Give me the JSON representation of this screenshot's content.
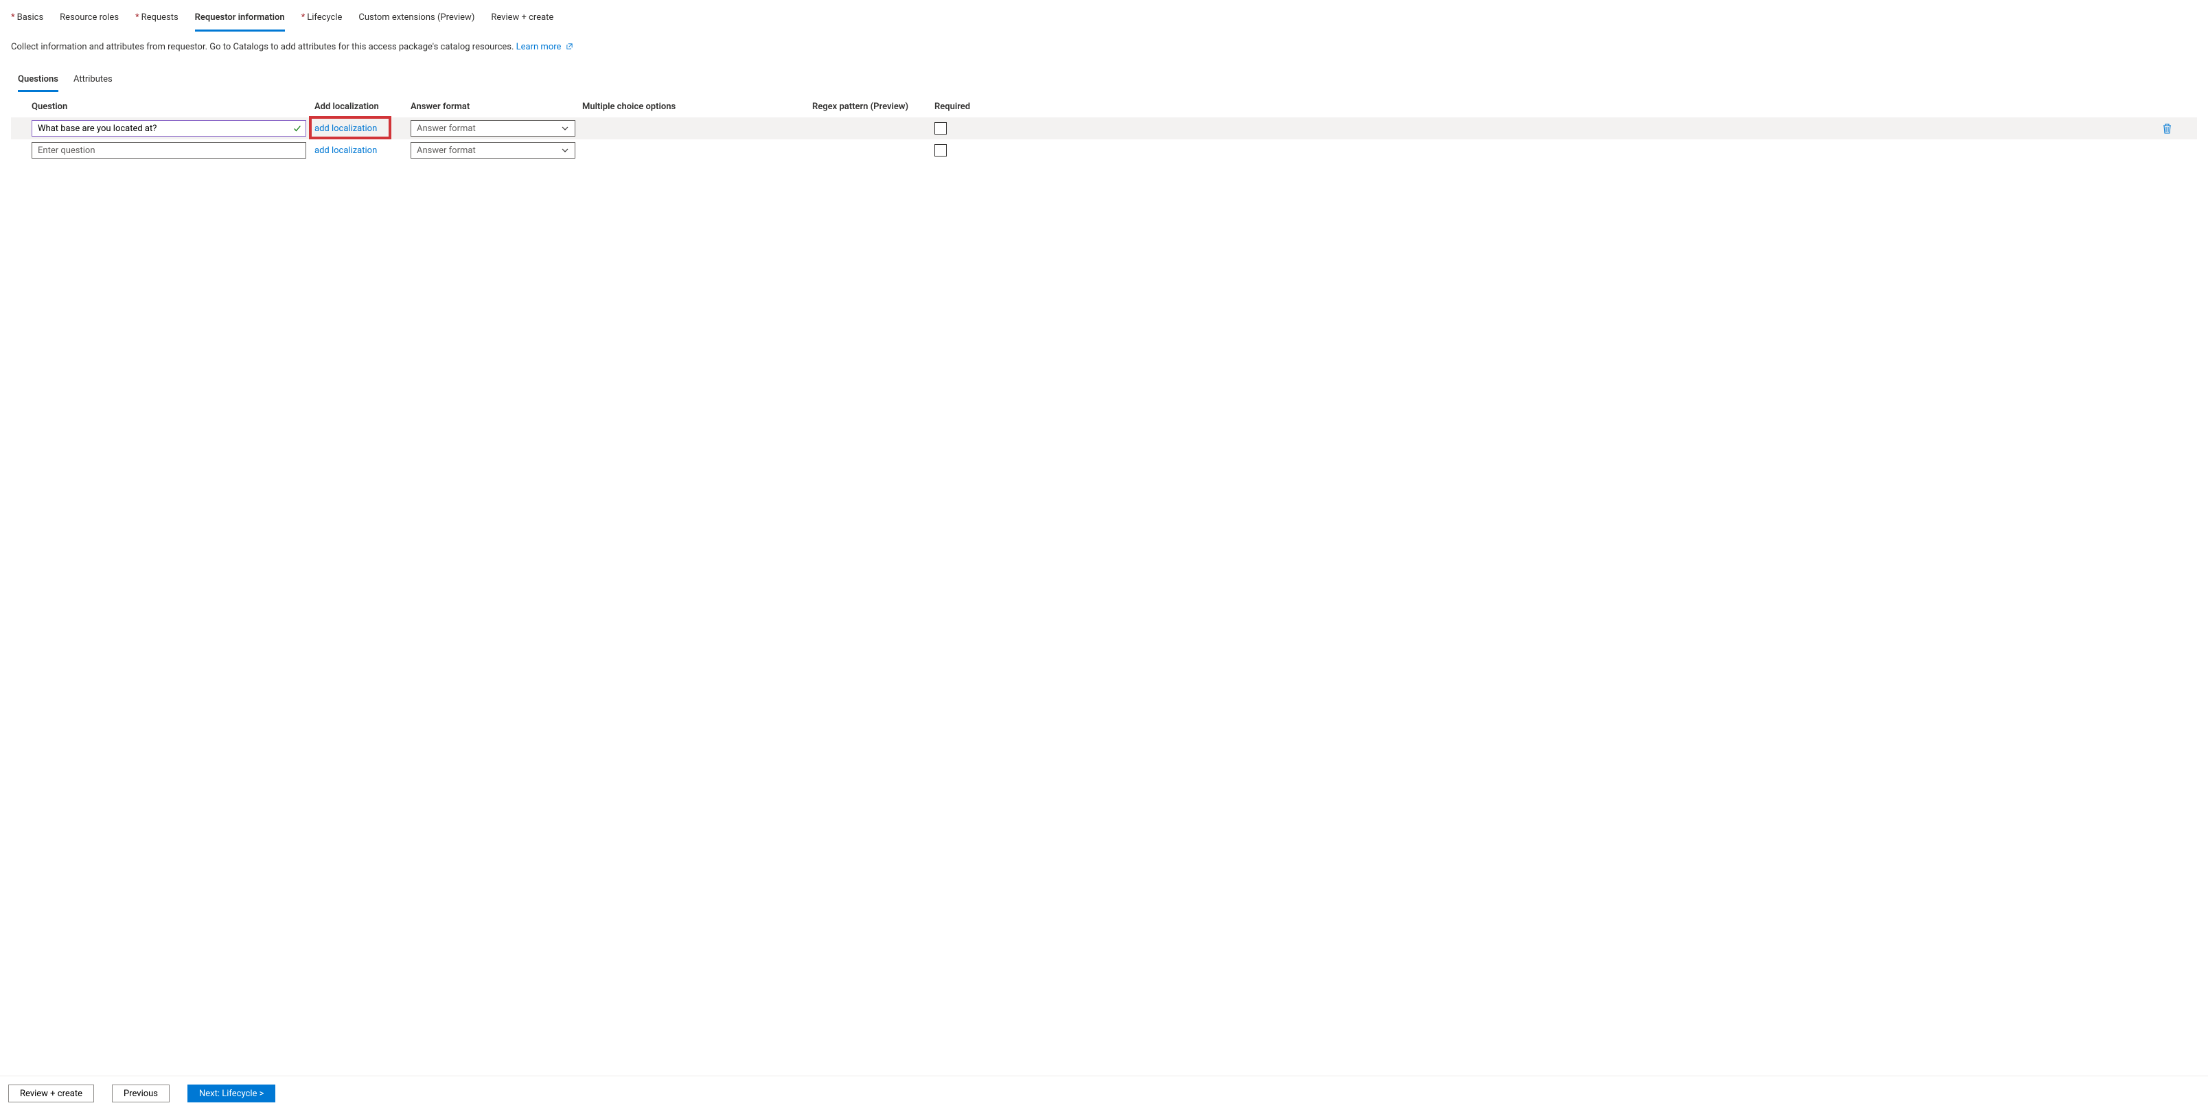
{
  "tabs": {
    "basics": {
      "label": "Basics",
      "required": true
    },
    "roles": {
      "label": "Resource roles",
      "required": false
    },
    "requests": {
      "label": "Requests",
      "required": true
    },
    "requestor": {
      "label": "Requestor information",
      "required": false
    },
    "lifecycle": {
      "label": "Lifecycle",
      "required": true
    },
    "custom": {
      "label": "Custom extensions (Preview)",
      "required": false
    },
    "review": {
      "label": "Review + create",
      "required": false
    }
  },
  "description": "Collect information and attributes from requestor. Go to Catalogs to add attributes for this access package's catalog resources.",
  "learn_more": "Learn more",
  "subtabs": {
    "questions": "Questions",
    "attributes": "Attributes"
  },
  "columns": {
    "question": "Question",
    "add_localization": "Add localization",
    "answer_format": "Answer format",
    "multiple_choice": "Multiple choice options",
    "regex": "Regex pattern (Preview)",
    "required": "Required"
  },
  "rows": [
    {
      "question_value": "What base are you located at?",
      "question_placeholder": "",
      "valid": true,
      "add_localization_label": "add localization",
      "answer_format_placeholder": "Answer format",
      "highlighted": true,
      "show_delete": true
    },
    {
      "question_value": "",
      "question_placeholder": "Enter question",
      "valid": false,
      "add_localization_label": "add localization",
      "answer_format_placeholder": "Answer format",
      "highlighted": false,
      "show_delete": false
    }
  ],
  "footer": {
    "review": "Review + create",
    "previous": "Previous",
    "next": "Next: Lifecycle >"
  }
}
